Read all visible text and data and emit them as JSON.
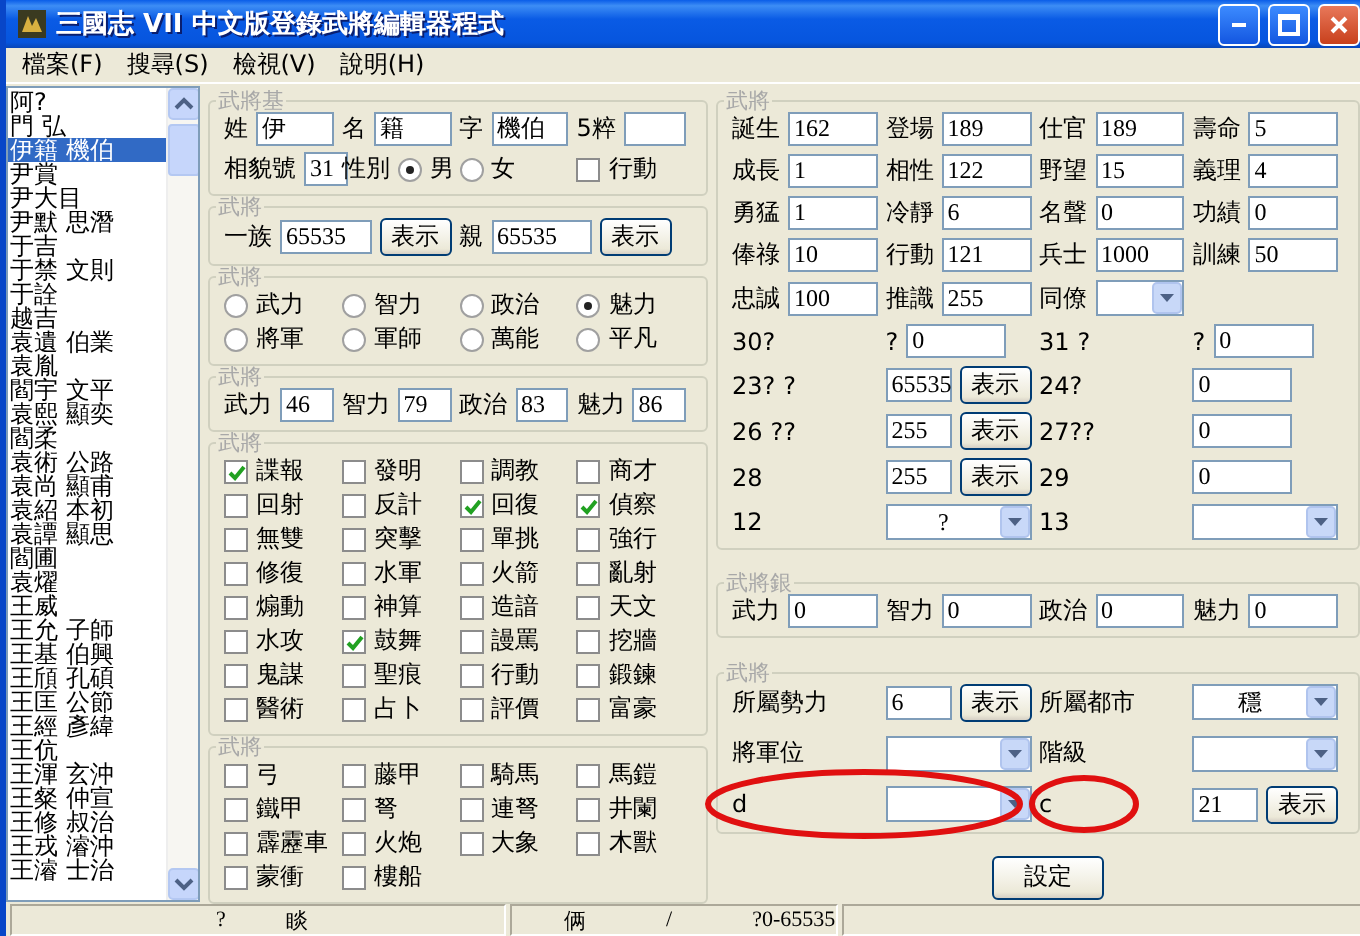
{
  "window": {
    "title": "三國志 VII 中文版登錄武將編輯器程式"
  },
  "menu": [
    {
      "label": "檔案(F)"
    },
    {
      "label": "搜尋(S)"
    },
    {
      "label": "檢視(V)"
    },
    {
      "label": "說明(H)"
    }
  ],
  "officer_list": [
    {
      "name": "阿?",
      "selected": false
    },
    {
      "name": "門 弘",
      "selected": false
    },
    {
      "name": "伊籍 機伯",
      "selected": true
    },
    {
      "name": "尹賞",
      "selected": false
    },
    {
      "name": "尹大目",
      "selected": false
    },
    {
      "name": "尹默 思潛",
      "selected": false
    },
    {
      "name": "于吉",
      "selected": false
    },
    {
      "name": "于禁 文則",
      "selected": false
    },
    {
      "name": "于詮",
      "selected": false
    },
    {
      "name": "越吉",
      "selected": false
    },
    {
      "name": "袁遺 伯業",
      "selected": false
    },
    {
      "name": "袁胤",
      "selected": false
    },
    {
      "name": "閻宇 文平",
      "selected": false
    },
    {
      "name": "袁熙 顯奕",
      "selected": false
    },
    {
      "name": "閻柔",
      "selected": false
    },
    {
      "name": "袁術 公路",
      "selected": false
    },
    {
      "name": "袁尚 顯甫",
      "selected": false
    },
    {
      "name": "袁紹 本初",
      "selected": false
    },
    {
      "name": "袁譚 顯思",
      "selected": false
    },
    {
      "name": "閻圃",
      "selected": false
    },
    {
      "name": "袁燿",
      "selected": false
    },
    {
      "name": "王威",
      "selected": false
    },
    {
      "name": "王允 子師",
      "selected": false
    },
    {
      "name": "王基 伯興",
      "selected": false
    },
    {
      "name": "王頎 孔碩",
      "selected": false
    },
    {
      "name": "王匡 公節",
      "selected": false
    },
    {
      "name": "王經 彥緯",
      "selected": false
    },
    {
      "name": "王伉",
      "selected": false
    },
    {
      "name": "王渾 玄沖",
      "selected": false
    },
    {
      "name": "王粲 仲宣",
      "selected": false
    },
    {
      "name": "王修 叔治",
      "selected": false
    },
    {
      "name": "王戎 濬沖",
      "selected": false
    },
    {
      "name": "王濬 士治",
      "selected": false
    }
  ],
  "left_groups": [
    {
      "title": "武將基",
      "rows": [
        [
          [
            {
              "kind": "field",
              "label": "姓",
              "value": "伊"
            }
          ],
          [
            {
              "kind": "field",
              "label": "名",
              "value": "籍"
            }
          ],
          [
            {
              "kind": "field",
              "label": "字",
              "value": "機伯"
            }
          ],
          [
            {
              "kind": "field",
              "label": "5粹"
            }
          ]
        ],
        [
          [
            {
              "kind": "field",
              "label": "相貌號",
              "value": "31"
            }
          ],
          [
            {
              "kind": "text",
              "text": "性別"
            },
            {
              "kind": "radio",
              "label": "男",
              "selected": true
            }
          ],
          [
            {
              "kind": "radio",
              "label": "女",
              "selected": false
            }
          ],
          [
            {
              "kind": "check",
              "label": "行動",
              "checked": false
            }
          ]
        ]
      ]
    },
    {
      "title": "武將",
      "rows": [
        [
          [
            {
              "kind": "field",
              "label": "一族",
              "value": "65535"
            },
            {
              "kind": "button",
              "label": "表示"
            }
          ],
          [
            {
              "kind": "field",
              "label": "親",
              "value": "65535"
            },
            {
              "kind": "button",
              "label": "表示"
            }
          ]
        ]
      ]
    },
    {
      "title": "武將",
      "rows": [
        [
          [
            {
              "kind": "radio",
              "label": "武力",
              "selected": false
            }
          ],
          [
            {
              "kind": "radio",
              "label": "智力",
              "selected": false
            }
          ],
          [
            {
              "kind": "radio",
              "label": "政治",
              "selected": false
            }
          ],
          [
            {
              "kind": "radio",
              "label": "魅力",
              "selected": true
            }
          ]
        ],
        [
          [
            {
              "kind": "radio",
              "label": "將軍",
              "selected": false
            }
          ],
          [
            {
              "kind": "radio",
              "label": "軍師",
              "selected": false
            }
          ],
          [
            {
              "kind": "radio",
              "label": "萬能",
              "selected": false
            }
          ],
          [
            {
              "kind": "radio",
              "label": "平凡",
              "selected": false
            }
          ]
        ]
      ]
    },
    {
      "title": "武將",
      "rows": [
        [
          [
            {
              "kind": "field",
              "label": "武力",
              "value": "46"
            }
          ],
          [
            {
              "kind": "field",
              "label": "智力",
              "value": "79"
            }
          ],
          [
            {
              "kind": "field",
              "label": "政治",
              "value": "83"
            }
          ],
          [
            {
              "kind": "field",
              "label": "魅力",
              "value": "86"
            }
          ]
        ]
      ]
    },
    {
      "title": "武將",
      "rows": [
        [
          [
            {
              "kind": "check",
              "label": "諜報",
              "checked": true
            }
          ],
          [
            {
              "kind": "check",
              "label": "發明",
              "checked": false
            }
          ],
          [
            {
              "kind": "check",
              "label": "調教",
              "checked": false
            }
          ],
          [
            {
              "kind": "check",
              "label": "商才",
              "checked": false
            }
          ]
        ],
        [
          [
            {
              "kind": "check",
              "label": "回射",
              "checked": false
            }
          ],
          [
            {
              "kind": "check",
              "label": "反計",
              "checked": false
            }
          ],
          [
            {
              "kind": "check",
              "label": "回復",
              "checked": true
            }
          ],
          [
            {
              "kind": "check",
              "label": "偵察",
              "checked": true
            }
          ]
        ],
        [
          [
            {
              "kind": "check",
              "label": "無雙",
              "checked": false
            }
          ],
          [
            {
              "kind": "check",
              "label": "突擊",
              "checked": false
            }
          ],
          [
            {
              "kind": "check",
              "label": "單挑",
              "checked": false
            }
          ],
          [
            {
              "kind": "check",
              "label": "強行",
              "checked": false
            }
          ]
        ],
        [
          [
            {
              "kind": "check",
              "label": "修復",
              "checked": false
            }
          ],
          [
            {
              "kind": "check",
              "label": "水軍",
              "checked": false
            }
          ],
          [
            {
              "kind": "check",
              "label": "火箭",
              "checked": false
            }
          ],
          [
            {
              "kind": "check",
              "label": "亂射",
              "checked": false
            }
          ]
        ],
        [
          [
            {
              "kind": "check",
              "label": "煽動",
              "checked": false
            }
          ],
          [
            {
              "kind": "check",
              "label": "神算",
              "checked": false
            }
          ],
          [
            {
              "kind": "check",
              "label": "造諳",
              "checked": false
            }
          ],
          [
            {
              "kind": "check",
              "label": "天文",
              "checked": false
            }
          ]
        ],
        [
          [
            {
              "kind": "check",
              "label": "水攻",
              "checked": false
            }
          ],
          [
            {
              "kind": "check",
              "label": "鼓舞",
              "checked": true
            }
          ],
          [
            {
              "kind": "check",
              "label": "謾罵",
              "checked": false
            }
          ],
          [
            {
              "kind": "check",
              "label": "挖牆",
              "checked": false
            }
          ]
        ],
        [
          [
            {
              "kind": "check",
              "label": "鬼謀",
              "checked": false
            }
          ],
          [
            {
              "kind": "check",
              "label": "聖痕",
              "checked": false
            }
          ],
          [
            {
              "kind": "check",
              "label": "行動",
              "checked": false
            }
          ],
          [
            {
              "kind": "check",
              "label": "鍛鍊",
              "checked": false
            }
          ]
        ],
        [
          [
            {
              "kind": "check",
              "label": "醫術",
              "checked": false
            }
          ],
          [
            {
              "kind": "check",
              "label": "占卜",
              "checked": false
            }
          ],
          [
            {
              "kind": "check",
              "label": "評價",
              "checked": false
            }
          ],
          [
            {
              "kind": "check",
              "label": "富豪",
              "checked": false
            }
          ]
        ]
      ]
    },
    {
      "title": "武將",
      "rows": [
        [
          [
            {
              "kind": "check",
              "label": "弓",
              "checked": false
            }
          ],
          [
            {
              "kind": "check",
              "label": "藤甲",
              "checked": false
            }
          ],
          [
            {
              "kind": "check",
              "label": "騎馬",
              "checked": false
            }
          ],
          [
            {
              "kind": "check",
              "label": "馬鎧",
              "checked": false
            }
          ]
        ],
        [
          [
            {
              "kind": "check",
              "label": "鐵甲",
              "checked": false
            }
          ],
          [
            {
              "kind": "check",
              "label": "弩",
              "checked": false
            }
          ],
          [
            {
              "kind": "check",
              "label": "連弩",
              "checked": false
            }
          ],
          [
            {
              "kind": "check",
              "label": "井闌",
              "checked": false
            }
          ]
        ],
        [
          [
            {
              "kind": "check",
              "label": "霹靂車",
              "checked": false
            }
          ],
          [
            {
              "kind": "check",
              "label": "火炮",
              "checked": false
            }
          ],
          [
            {
              "kind": "check",
              "label": "大象",
              "checked": false
            }
          ],
          [
            {
              "kind": "check",
              "label": "木獸",
              "checked": false
            }
          ]
        ],
        [
          [
            {
              "kind": "check",
              "label": "蒙衝",
              "checked": false
            }
          ],
          [
            {
              "kind": "check",
              "label": "樓船",
              "checked": false
            }
          ]
        ]
      ]
    }
  ],
  "right_groups": [
    {
      "title": "武將",
      "rows": [
        [
          [
            {
              "kind": "field",
              "label": "誕生",
              "value": "162"
            }
          ],
          [
            {
              "kind": "field",
              "label": "登場",
              "value": "189"
            }
          ],
          [
            {
              "kind": "field",
              "label": "仕官",
              "value": "189"
            }
          ],
          [
            {
              "kind": "field",
              "label": "壽命",
              "value": "5"
            }
          ]
        ],
        [
          [
            {
              "kind": "field",
              "label": "成長",
              "value": "1"
            }
          ],
          [
            {
              "kind": "field",
              "label": "相性",
              "value": "122"
            }
          ],
          [
            {
              "kind": "field",
              "label": "野望",
              "value": "15"
            }
          ],
          [
            {
              "kind": "field",
              "label": "義理",
              "value": "4"
            }
          ]
        ],
        [
          [
            {
              "kind": "field",
              "label": "勇猛",
              "value": "1"
            }
          ],
          [
            {
              "kind": "field",
              "label": "冷靜",
              "value": "6"
            }
          ],
          [
            {
              "kind": "field",
              "label": "名聲",
              "value": "0"
            }
          ],
          [
            {
              "kind": "field",
              "label": "功績",
              "value": "0"
            }
          ]
        ],
        [
          [
            {
              "kind": "field",
              "label": "俸祿",
              "value": "10"
            }
          ],
          [
            {
              "kind": "field",
              "label": "行動",
              "value": "121"
            }
          ],
          [
            {
              "kind": "field",
              "label": "兵士",
              "value": "1000"
            }
          ],
          [
            {
              "kind": "field",
              "label": "訓練",
              "value": "50"
            }
          ]
        ],
        [
          [
            {
              "kind": "field",
              "label": "忠誠",
              "value": "100"
            }
          ],
          [
            {
              "kind": "field",
              "label": "推識",
              "value": "255"
            }
          ],
          [
            {
              "kind": "text",
              "text": "同僚"
            },
            {
              "kind": "select"
            }
          ]
        ],
        [
          [
            {
              "kind": "text",
              "text": "30?"
            }
          ],
          [
            {
              "kind": "text",
              "text": "?"
            },
            {
              "kind": "input",
              "value": "0"
            }
          ],
          [
            {
              "kind": "text",
              "text": "31"
            },
            {
              "kind": "text",
              "text": "?"
            }
          ],
          [
            {
              "kind": "text",
              "text": "?"
            },
            {
              "kind": "input",
              "value": "0"
            }
          ]
        ],
        [
          [
            {
              "kind": "text",
              "text": "23?"
            },
            {
              "kind": "text",
              "text": "?"
            }
          ],
          [
            {
              "kind": "input",
              "value": "65535"
            },
            {
              "kind": "button",
              "label": "表示"
            }
          ],
          [
            {
              "kind": "text",
              "text": "24?"
            }
          ],
          [
            {
              "kind": "input",
              "value": "0"
            }
          ]
        ],
        [
          [
            {
              "kind": "text",
              "text": "26"
            },
            {
              "kind": "text",
              "text": "??"
            }
          ],
          [
            {
              "kind": "input",
              "value": "255"
            },
            {
              "kind": "button",
              "label": "表示"
            }
          ],
          [
            {
              "kind": "text",
              "text": "27??"
            }
          ],
          [
            {
              "kind": "input",
              "value": "0"
            }
          ]
        ],
        [
          [
            {
              "kind": "text",
              "text": "28"
            }
          ],
          [
            {
              "kind": "input",
              "value": "255"
            },
            {
              "kind": "button",
              "label": "表示"
            }
          ],
          [
            {
              "kind": "text",
              "text": "29"
            }
          ],
          [
            {
              "kind": "input",
              "value": "0"
            }
          ]
        ],
        [
          [
            {
              "kind": "text",
              "text": "12"
            }
          ],
          [
            {
              "kind": "select",
              "value": "?"
            }
          ],
          [
            {
              "kind": "text",
              "text": "13"
            }
          ],
          [
            {
              "kind": "select"
            }
          ]
        ]
      ]
    },
    {
      "title": "武將銀",
      "rows": [
        [
          [
            {
              "kind": "field",
              "label": "武力",
              "value": "0"
            }
          ],
          [
            {
              "kind": "field",
              "label": "智力",
              "value": "0"
            }
          ],
          [
            {
              "kind": "field",
              "label": "政治",
              "value": "0"
            }
          ],
          [
            {
              "kind": "field",
              "label": "魅力",
              "value": "0"
            }
          ]
        ]
      ]
    },
    {
      "title": "武將",
      "rows": [
        [
          [
            {
              "kind": "text",
              "text": "所屬勢力"
            }
          ],
          [
            {
              "kind": "input",
              "value": "6"
            },
            {
              "kind": "button",
              "label": "表示"
            }
          ],
          [
            {
              "kind": "text",
              "text": "所屬都市"
            }
          ],
          [
            {
              "kind": "select",
              "value": "穩"
            }
          ]
        ],
        [
          [
            {
              "kind": "text",
              "text": "將軍位"
            }
          ],
          [
            {
              "kind": "select"
            }
          ],
          [
            {
              "kind": "text",
              "text": "階級"
            }
          ],
          [
            {
              "kind": "select"
            }
          ]
        ],
        [
          [
            {
              "kind": "text",
              "text": "d"
            }
          ],
          [
            {
              "kind": "select"
            }
          ],
          [
            {
              "kind": "text",
              "text": "c"
            }
          ],
          [
            {
              "kind": "input",
              "value": "21"
            },
            {
              "kind": "button",
              "label": "表示"
            }
          ]
        ]
      ]
    }
  ],
  "buttons": [
    {
      "label": "設定"
    }
  ],
  "status_bar": [
    {
      "items": [
        "?",
        "睒"
      ]
    },
    {
      "items": [
        "俩",
        "/",
        "?0-65535"
      ]
    }
  ]
}
